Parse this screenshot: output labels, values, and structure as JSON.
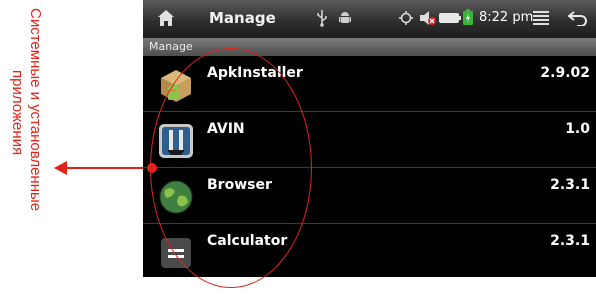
{
  "caption": {
    "line1": "Системные и установленные",
    "line2": "приложения"
  },
  "status_bar": {
    "title": "Manage",
    "time": "8:22 pm"
  },
  "subheader": {
    "title": "Manage"
  },
  "apps": [
    {
      "name": "ApkInstaller",
      "version": "2.9.02",
      "icon": "apk-installer-icon"
    },
    {
      "name": "AVIN",
      "version": "1.0",
      "icon": "avin-icon"
    },
    {
      "name": "Browser",
      "version": "2.3.1",
      "icon": "browser-icon"
    },
    {
      "name": "Calculator",
      "version": "2.3.1",
      "icon": "calculator-icon"
    }
  ],
  "colors": {
    "annotation": "#e2231a",
    "screen_background": "#000000"
  }
}
